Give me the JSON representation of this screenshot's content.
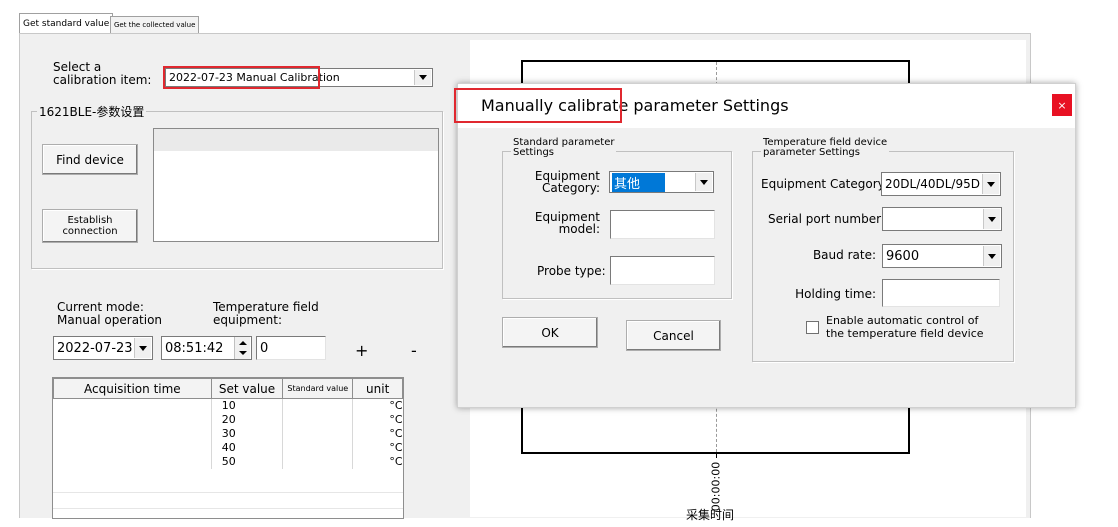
{
  "tabs": [
    "Get standard value",
    "Get the collected value"
  ],
  "calibration": {
    "select_label": "Select a\ncalibration item:",
    "selected_value": "2022-07-23 Manual Calibration"
  },
  "device_group": {
    "title": "1621BLE-参数设置",
    "find_button": "Find device",
    "establish_button": "Establish\nconnection"
  },
  "mode": {
    "current_mode": "Current mode:\nManual operation",
    "temp_field_label": "Temperature field\nequipment:",
    "date": "2022-07-23",
    "time": "08:51:42",
    "number": "0",
    "plus": "+",
    "minus": "-"
  },
  "table": {
    "headers": [
      "Acquisition time",
      "Set value",
      "Standard value",
      "unit"
    ],
    "rows": [
      {
        "time": "",
        "set": "10",
        "std": "",
        "unit": "°C"
      },
      {
        "time": "",
        "set": "20",
        "std": "",
        "unit": "°C"
      },
      {
        "time": "",
        "set": "30",
        "std": "",
        "unit": "°C"
      },
      {
        "time": "",
        "set": "40",
        "std": "",
        "unit": "°C"
      },
      {
        "time": "",
        "set": "50",
        "std": "",
        "unit": "°C"
      }
    ]
  },
  "chart": {
    "x_tick": "00:00:00",
    "x_label": "采集时间"
  },
  "dialog": {
    "title": "Manually calibrate parameter Settings",
    "close": "×",
    "standard_group": "Standard parameter\nSettings",
    "equipment_category_label": "Equipment\nCategory:",
    "equipment_category_value": "其他",
    "equipment_model_label": "Equipment\nmodel:",
    "equipment_model_value": "",
    "probe_type_label": "Probe type:",
    "probe_type_value": "",
    "ok": "OK",
    "cancel": "Cancel",
    "temp_group": "Temperature field device\nparameter Settings",
    "temp_category_label": "Equipment Category:",
    "temp_category_value": "20DL/40DL/95D",
    "serial_label": "Serial port number:",
    "serial_value": "",
    "baud_label": "Baud rate:",
    "baud_value": "9600",
    "holding_label": "Holding time:",
    "holding_value": "",
    "auto_control": "Enable automatic control of\nthe temperature field device"
  }
}
